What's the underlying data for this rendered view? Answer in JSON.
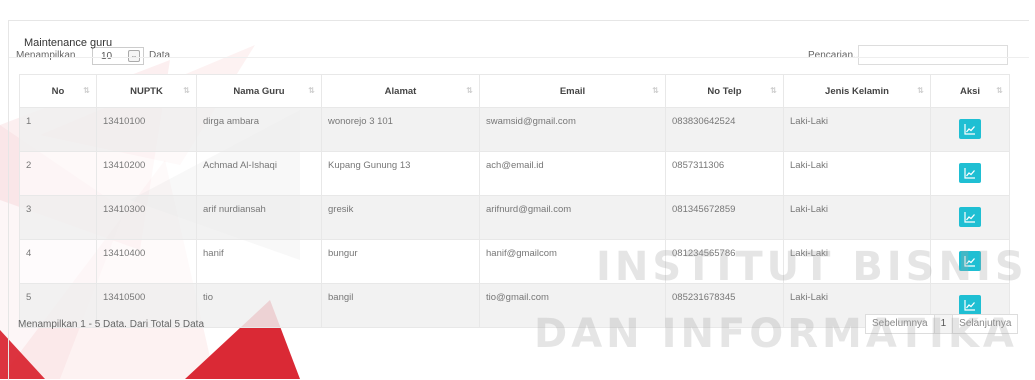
{
  "panel": {
    "title": "Maintenance guru"
  },
  "length_menu": {
    "label_before": "Menampilkan",
    "value": "10",
    "label_after": "Data"
  },
  "search": {
    "label": "Pencarian..",
    "placeholder": ""
  },
  "table": {
    "columns": [
      "No",
      "NUPTK",
      "Nama Guru",
      "Alamat",
      "Email",
      "No Telp",
      "Jenis Kelamin",
      "Aksi"
    ],
    "rows": [
      {
        "no": "1",
        "nuptk": "13410100",
        "nama": "dirga ambara",
        "alamat": "wonorejo 3 101",
        "email": "swamsid@gmail.com",
        "telp": "083830642524",
        "jk": "Laki-Laki"
      },
      {
        "no": "2",
        "nuptk": "13410200",
        "nama": "Achmad Al-Ishaqi",
        "alamat": "Kupang Gunung 13",
        "email": "ach@email.id",
        "telp": "0857311306",
        "jk": "Laki-Laki"
      },
      {
        "no": "3",
        "nuptk": "13410300",
        "nama": "arif nurdiansah",
        "alamat": "gresik",
        "email": "arifnurd@gmail.com",
        "telp": "081345672859",
        "jk": "Laki-Laki"
      },
      {
        "no": "4",
        "nuptk": "13410400",
        "nama": "hanif",
        "alamat": "bungur",
        "email": "hanif@gmailcom",
        "telp": "081234565786",
        "jk": "Laki-Laki"
      },
      {
        "no": "5",
        "nuptk": "13410500",
        "nama": "tio",
        "alamat": "bangil",
        "email": "tio@gmail.com",
        "telp": "085231678345",
        "jk": "Laki-Laki"
      }
    ],
    "action_icon": "chart-line-icon"
  },
  "info": "Menampilkan 1 - 5 Data. Dari Total 5 Data",
  "pagination": {
    "previous": "Sebelumnya",
    "current": "1",
    "next": "Selanjutnya"
  },
  "watermark": {
    "line1": "INSTITUT BISNIS",
    "line2": "DAN INFORMATIKA"
  },
  "colors": {
    "accent": "#1fbfd3",
    "watermark_red": "#d81e2a"
  }
}
